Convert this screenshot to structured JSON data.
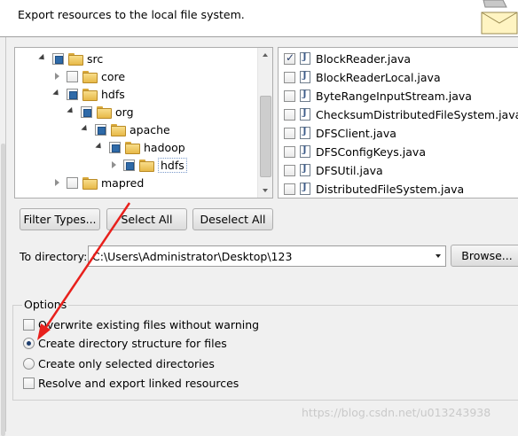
{
  "header": {
    "description": "Export resources to the local file system."
  },
  "tree": {
    "items": [
      {
        "label": "src",
        "state": "partial",
        "expander": "open",
        "depth": 0
      },
      {
        "label": "core",
        "state": "empty",
        "expander": "closed",
        "depth": 1
      },
      {
        "label": "hdfs",
        "state": "partial",
        "expander": "open",
        "depth": 1
      },
      {
        "label": "org",
        "state": "partial",
        "expander": "open",
        "depth": 2
      },
      {
        "label": "apache",
        "state": "partial",
        "expander": "open",
        "depth": 3
      },
      {
        "label": "hadoop",
        "state": "partial",
        "expander": "open",
        "depth": 4
      },
      {
        "label": "hdfs",
        "state": "partial",
        "expander": "closed",
        "depth": 5,
        "selected": true
      },
      {
        "label": "mapred",
        "state": "empty",
        "expander": "closed",
        "depth": 1
      }
    ]
  },
  "files": {
    "items": [
      {
        "label": "BlockReader.java",
        "checked": true
      },
      {
        "label": "BlockReaderLocal.java",
        "checked": false
      },
      {
        "label": "ByteRangeInputStream.java",
        "checked": false
      },
      {
        "label": "ChecksumDistributedFileSystem.java",
        "checked": false
      },
      {
        "label": "DFSClient.java",
        "checked": false
      },
      {
        "label": "DFSConfigKeys.java",
        "checked": false
      },
      {
        "label": "DFSUtil.java",
        "checked": false
      },
      {
        "label": "DistributedFileSystem.java",
        "checked": false
      }
    ]
  },
  "buttons": {
    "filter_types": "Filter Types...",
    "select_all": "Select All",
    "deselect_all": "Deselect All",
    "browse": "Browse..."
  },
  "directory": {
    "label": "To directory:",
    "value": "C:\\Users\\Administrator\\Desktop\\123"
  },
  "options": {
    "title": "Options",
    "overwrite": {
      "label": "Overwrite existing files without warning",
      "checked": false
    },
    "create_structure": {
      "label": "Create directory structure for files",
      "selected": true
    },
    "create_selected": {
      "label": "Create only selected directories",
      "selected": false
    },
    "resolve_linked": {
      "label": "Resolve and export linked resources",
      "checked": false
    }
  },
  "watermark": "https://blog.csdn.net/u013243938",
  "annotation": {
    "arrow_color": "#e8201c"
  }
}
